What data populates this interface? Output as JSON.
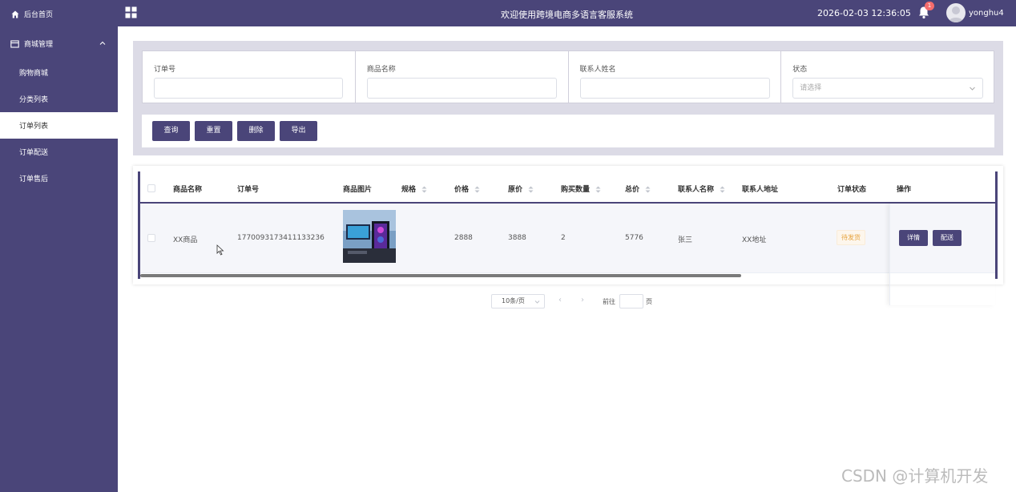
{
  "sidebar": {
    "home": "后台首页",
    "mall_group": "商城管理",
    "items": [
      "购物商城",
      "分类列表",
      "订单列表",
      "订单配送",
      "订单售后"
    ],
    "active_item": "订单列表"
  },
  "header": {
    "title": "欢迎使用跨境电商多语言客服系统",
    "datetime": "2026-02-03 12:36:05",
    "notification_count": "1",
    "username": "yonghu4"
  },
  "search": {
    "fields": [
      {
        "label": "订单号",
        "value": ""
      },
      {
        "label": "商品名称",
        "value": ""
      },
      {
        "label": "联系人姓名",
        "value": ""
      },
      {
        "label": "状态",
        "placeholder": "请选择"
      }
    ],
    "buttons": [
      "查询",
      "重置",
      "删除",
      "导出"
    ]
  },
  "table": {
    "columns": [
      "商品名称",
      "订单号",
      "商品图片",
      "规格",
      "价格",
      "原价",
      "购买数量",
      "总价",
      "联系人名称",
      "联系人地址",
      "订单状态",
      "操作"
    ],
    "rows": [
      {
        "product_name": "XX商品",
        "order_no": "1770093173411133236",
        "spec": "",
        "price": "2888",
        "original_price": "3888",
        "quantity": "2",
        "total": "5776",
        "contact_name": "张三",
        "contact_address": "XX地址",
        "status": "待发货",
        "actions": [
          "详情",
          "配送"
        ]
      }
    ]
  },
  "pagination": {
    "page_size": "10条/页",
    "goto_label": "前往",
    "page_label": "页"
  },
  "colors": {
    "primary": "#4a4579",
    "status_pending": "#e6a23c"
  },
  "watermark": "CSDN @计算机开发"
}
